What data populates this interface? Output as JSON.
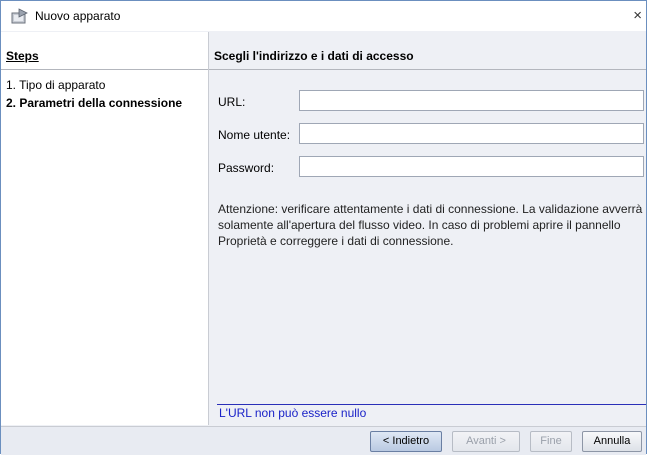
{
  "window": {
    "title": "Nuovo apparato",
    "close_glyph": "×",
    "title_icon": "wizard-app-icon"
  },
  "steps": {
    "header": "Steps",
    "items": [
      {
        "label": "1. Tipo di apparato",
        "current": false
      },
      {
        "label": "2. Parametri della connessione",
        "current": true
      }
    ]
  },
  "main": {
    "header": "Scegli l'indirizzo e i dati di accesso",
    "fields": {
      "url": {
        "label": "URL:",
        "value": ""
      },
      "username": {
        "label": "Nome utente:",
        "value": ""
      },
      "password": {
        "label": "Password:",
        "value": ""
      }
    },
    "warning": "Attenzione: verificare attentamente i dati di connessione. La validazione avverrà solamente all'apertura del flusso video. In caso di problemi aprire il pannello Proprietà e correggere i dati di connessione.",
    "error": "L'URL non può essere nullo"
  },
  "buttons": {
    "back": "< Indietro",
    "next": "Avanti >",
    "finish": "Fine",
    "cancel": "Annulla"
  },
  "colors": {
    "error_text": "#1a22c8",
    "window_border": "#6b8fbf"
  }
}
